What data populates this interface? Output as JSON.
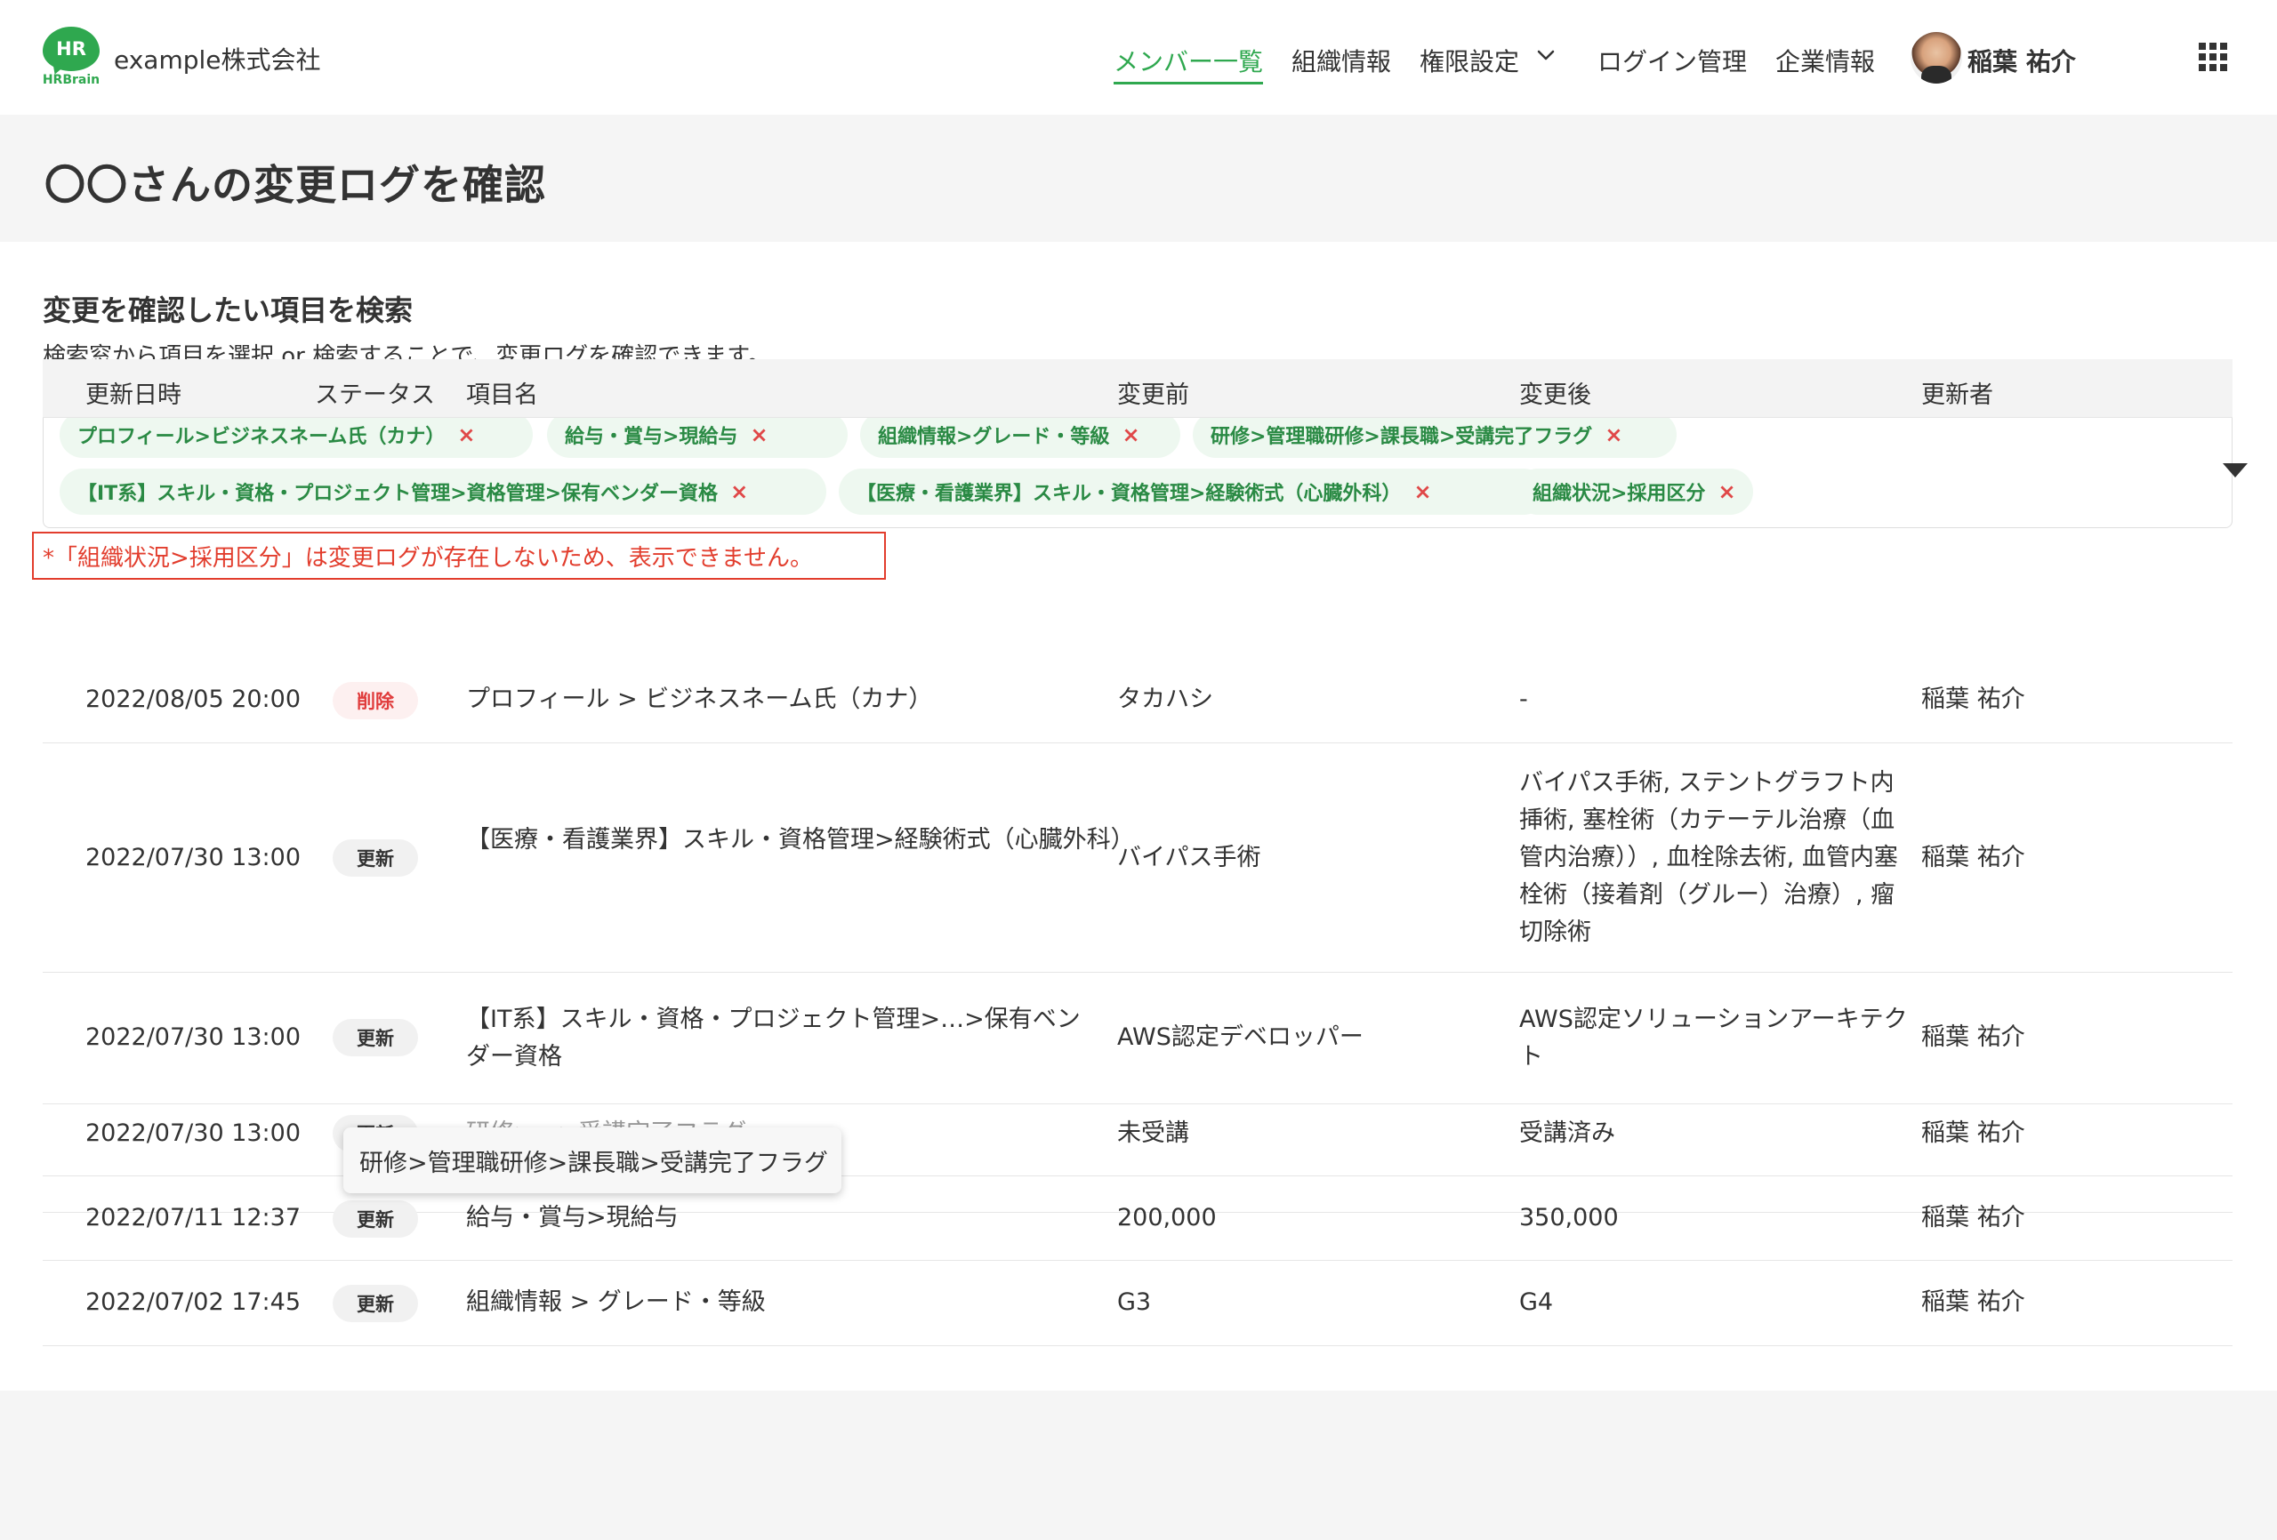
{
  "header": {
    "logo_text": "HR",
    "logo_sub": "HRBrain",
    "company": "example株式会社",
    "nav": [
      {
        "label": "メンバー一覧"
      },
      {
        "label": "組織情報"
      },
      {
        "label": "権限設定"
      },
      {
        "label": "ログイン管理"
      },
      {
        "label": "企業情報"
      }
    ],
    "user_name": "稲葉 祐介"
  },
  "page": {
    "title": "〇〇さんの変更ログを確認"
  },
  "search": {
    "title": "変更を確認したい項目を検索",
    "description": "検索窓から項目を選択 or 検索することで、変更ログを確認できます。",
    "tags": [
      {
        "label": "プロフィール>ビジネスネーム氏（カナ）"
      },
      {
        "label": "給与・賞与>現給与"
      },
      {
        "label": "組織情報>グレード・等級"
      },
      {
        "label": "研修>管理職研修>課長職>受講完了フラグ"
      },
      {
        "label": "【IT系】スキル・資格・プロジェクト管理>資格管理>保有ベンダー資格"
      },
      {
        "label": "【医療・看護業界】スキル・資格管理>経験術式（心臓外科）"
      },
      {
        "label": "組織状況>採用区分"
      }
    ],
    "remove_glyph": "×",
    "warning": "*「組織状況>採用区分」は変更ログが存在しないため、表示できません。"
  },
  "table": {
    "headers": {
      "date": "更新日時",
      "status": "ステータス",
      "item": "項目名",
      "before": "変更前",
      "after": "変更後",
      "updater": "更新者"
    },
    "rows": [
      {
        "date": "2022/08/05 20:00",
        "status": "削除",
        "item": "プロフィール > ビジネスネーム氏（カナ）",
        "before": "タカハシ",
        "after": "-",
        "updater": "稲葉 祐介"
      },
      {
        "date": "2022/07/30 13:00",
        "status": "更新",
        "item": "【医療・看護業界】スキル・資格管理>経験術式（心臓外科）",
        "before": "バイパス手術",
        "after": "バイパス手術, ステントグラフト内挿術, 塞栓術（カテーテル治療（血管内治療））, 血栓除去術, 血管内塞栓術（接着剤（グルー）治療）, 瘤切除術",
        "updater": "稲葉 祐介"
      },
      {
        "date": "2022/07/30 13:00",
        "status": "更新",
        "item": "【IT系】スキル・資格・プロジェクト管理>…>保有ベンダー資格",
        "before": "AWS認定デベロッパー",
        "after": "AWS認定ソリューションアーキテクト",
        "updater": "稲葉 祐介"
      },
      {
        "date": "2022/07/30 13:00",
        "status": "更新",
        "item": "研修>…>受講完了フラグ",
        "before": "未受講",
        "after": "受講済み",
        "updater": "稲葉 祐介"
      },
      {
        "date": "2022/07/11 12:37",
        "status": "更新",
        "item": "給与・賞与>現給与",
        "before": "200,000",
        "after": "350,000",
        "updater": "稲葉 祐介"
      },
      {
        "date": "2022/07/02 17:45",
        "status": "更新",
        "item": "組織情報 > グレード・等級",
        "before": "G3",
        "after": "G4",
        "updater": "稲葉 祐介"
      }
    ],
    "tooltip": "研修>管理職研修>課長職>受講完了フラグ"
  },
  "colors": {
    "brand": "#2fa84f",
    "warning": "#e23d2d",
    "delete": "#e03c3c"
  },
  "icons": {
    "nav_dropdown": "chevron-down-icon",
    "app_launcher": "grid-icon",
    "tag_dropdown": "caret-down-icon"
  }
}
